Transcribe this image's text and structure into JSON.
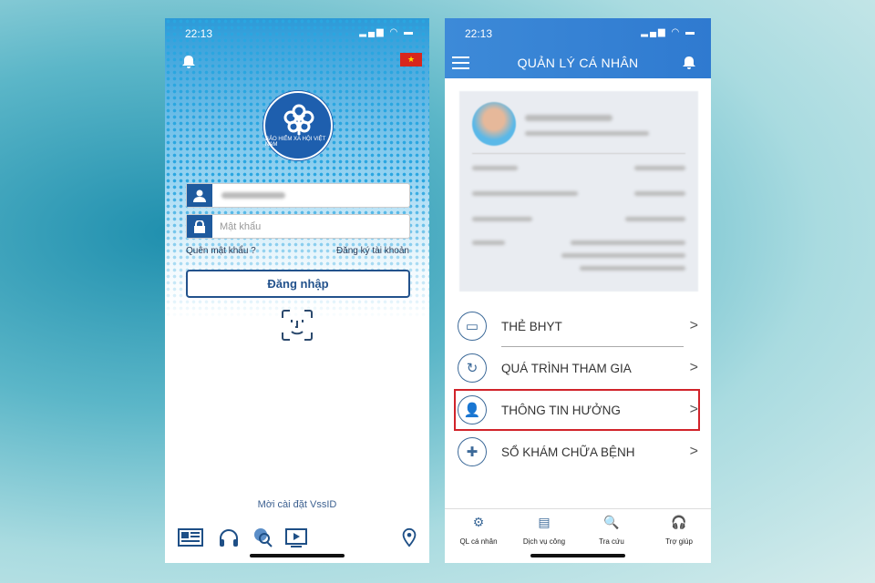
{
  "left": {
    "status_time": "22:13",
    "logo_text": "BẢO HIỂM XÃ HỘI VIỆT NAM",
    "password_placeholder": "Mật khẩu",
    "forgot_password": "Quên mật khẩu ?",
    "register": "Đăng ký tài khoản",
    "login_button": "Đăng nhập",
    "invite": "Mời cài đặt VssID",
    "bottom_icons": [
      "news-icon",
      "headset-icon",
      "search-globe-icon",
      "video-icon",
      "location-pin-icon"
    ]
  },
  "right": {
    "status_time": "22:13",
    "header_title": "QUẢN LÝ CÁ NHÂN",
    "menu_items": [
      {
        "label": "THẺ BHYT",
        "icon": "health-card-icon"
      },
      {
        "label": "QUÁ TRÌNH THAM GIA",
        "icon": "refresh-icon"
      },
      {
        "label": "THÔNG TIN HƯỞNG",
        "icon": "user-clock-icon",
        "highlighted": true
      },
      {
        "label": "SỔ KHÁM CHỮA BỆNH",
        "icon": "medical-cross-icon"
      }
    ],
    "tabs": [
      {
        "label": "QL cá nhân",
        "icon": "user-gear-icon",
        "active": true
      },
      {
        "label": "Dịch vụ công",
        "icon": "document-icon"
      },
      {
        "label": "Tra cứu",
        "icon": "search-globe-icon"
      },
      {
        "label": "Trợ giúp",
        "icon": "headset-icon"
      }
    ]
  },
  "colors": {
    "brand_blue": "#1e5a9e",
    "header_blue": "#3d8ad8",
    "highlight_red": "#d1232a"
  }
}
